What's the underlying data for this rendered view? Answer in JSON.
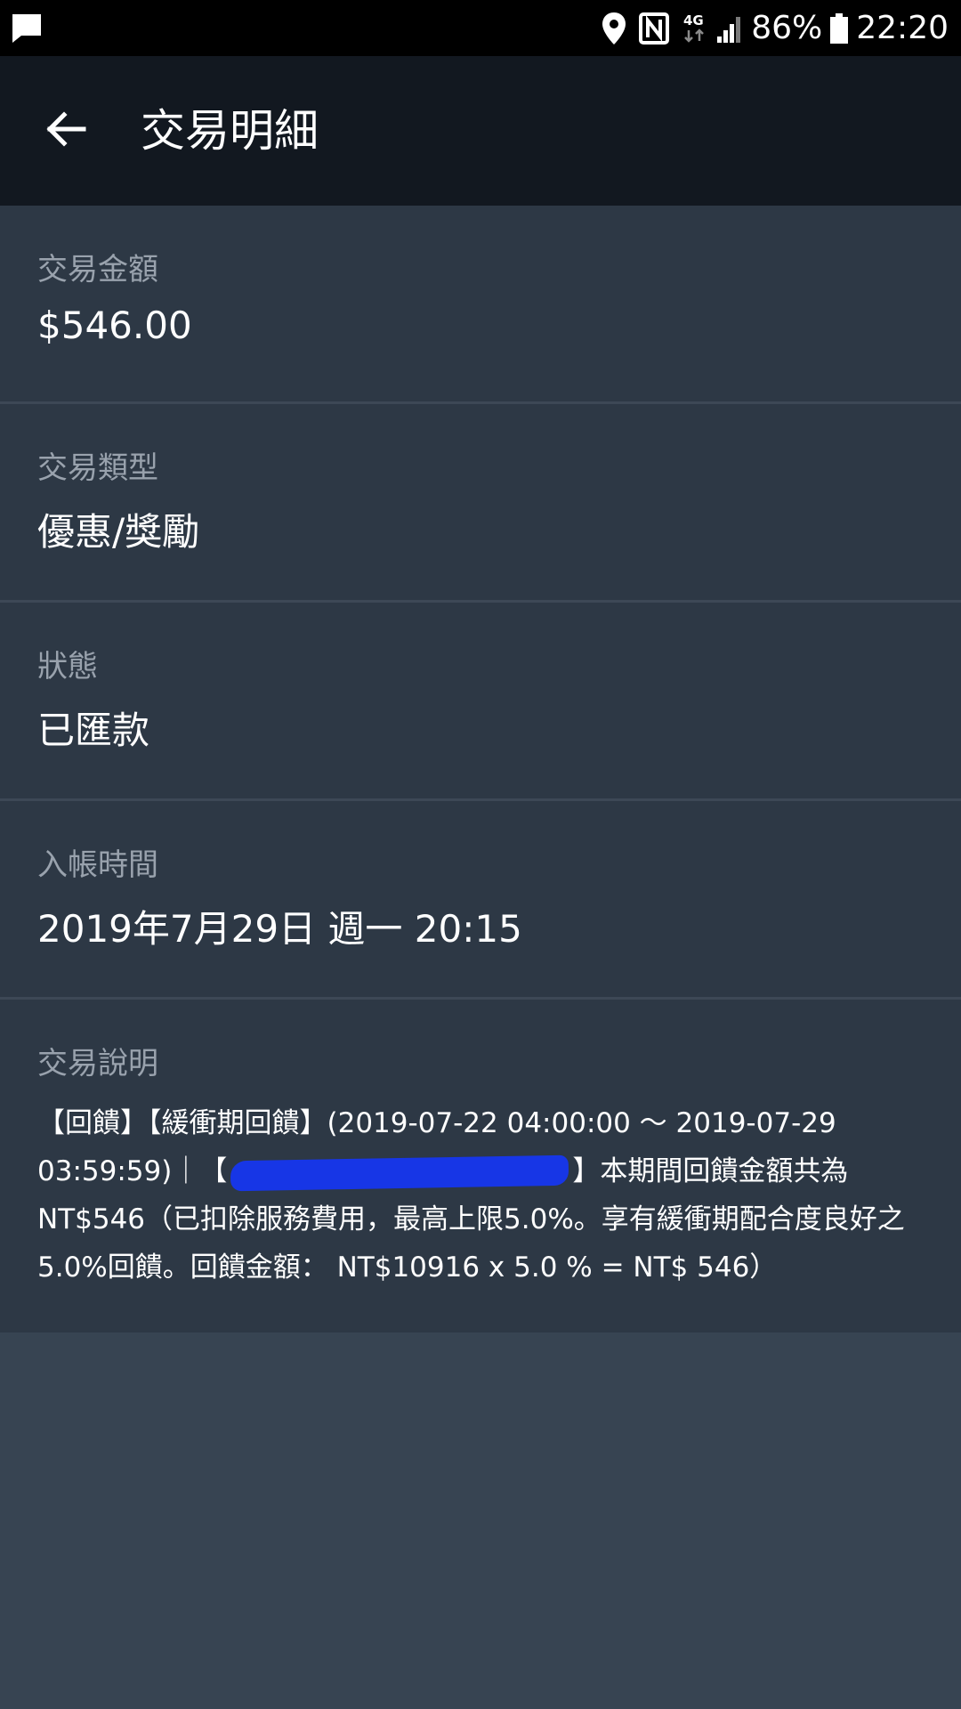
{
  "status_bar": {
    "battery": "86%",
    "time": "22:20",
    "network": "4G",
    "icons": [
      "message-icon",
      "location-icon",
      "nfc-icon",
      "network-4g-icon",
      "signal-icon",
      "battery-icon"
    ]
  },
  "app_bar": {
    "title": "交易明細",
    "back_icon": "back-arrow-icon"
  },
  "details": {
    "amount": {
      "label": "交易金額",
      "value": "$546.00"
    },
    "type": {
      "label": "交易類型",
      "value": "優惠/獎勵"
    },
    "status": {
      "label": "狀態",
      "value": "已匯款"
    },
    "time": {
      "label": "入帳時間",
      "value": "2019年7月29日 週一 20:15"
    },
    "description": {
      "label": "交易說明",
      "line1": "【回饋】【緩衝期回饋】(2019-07-22 04:00:00 ～ 2019-07-29",
      "line2_before": "03:59:59)｜【",
      "line2_after": "】本期間回饋金額共為",
      "line3": "NT$546（已扣除服務費用，最高上限5.0%。享有緩衝期配合度良好之",
      "line4": "5.0%回饋。回饋金額： NT$10916 x 5.0 % = NT$ 546）"
    }
  },
  "colors": {
    "status_bar_bg": "#000000",
    "app_bar_bg": "#121820",
    "card_bg": "#2d3845",
    "page_bg": "#374452",
    "label_color": "#99a2ad",
    "redaction": "#1736e6"
  }
}
